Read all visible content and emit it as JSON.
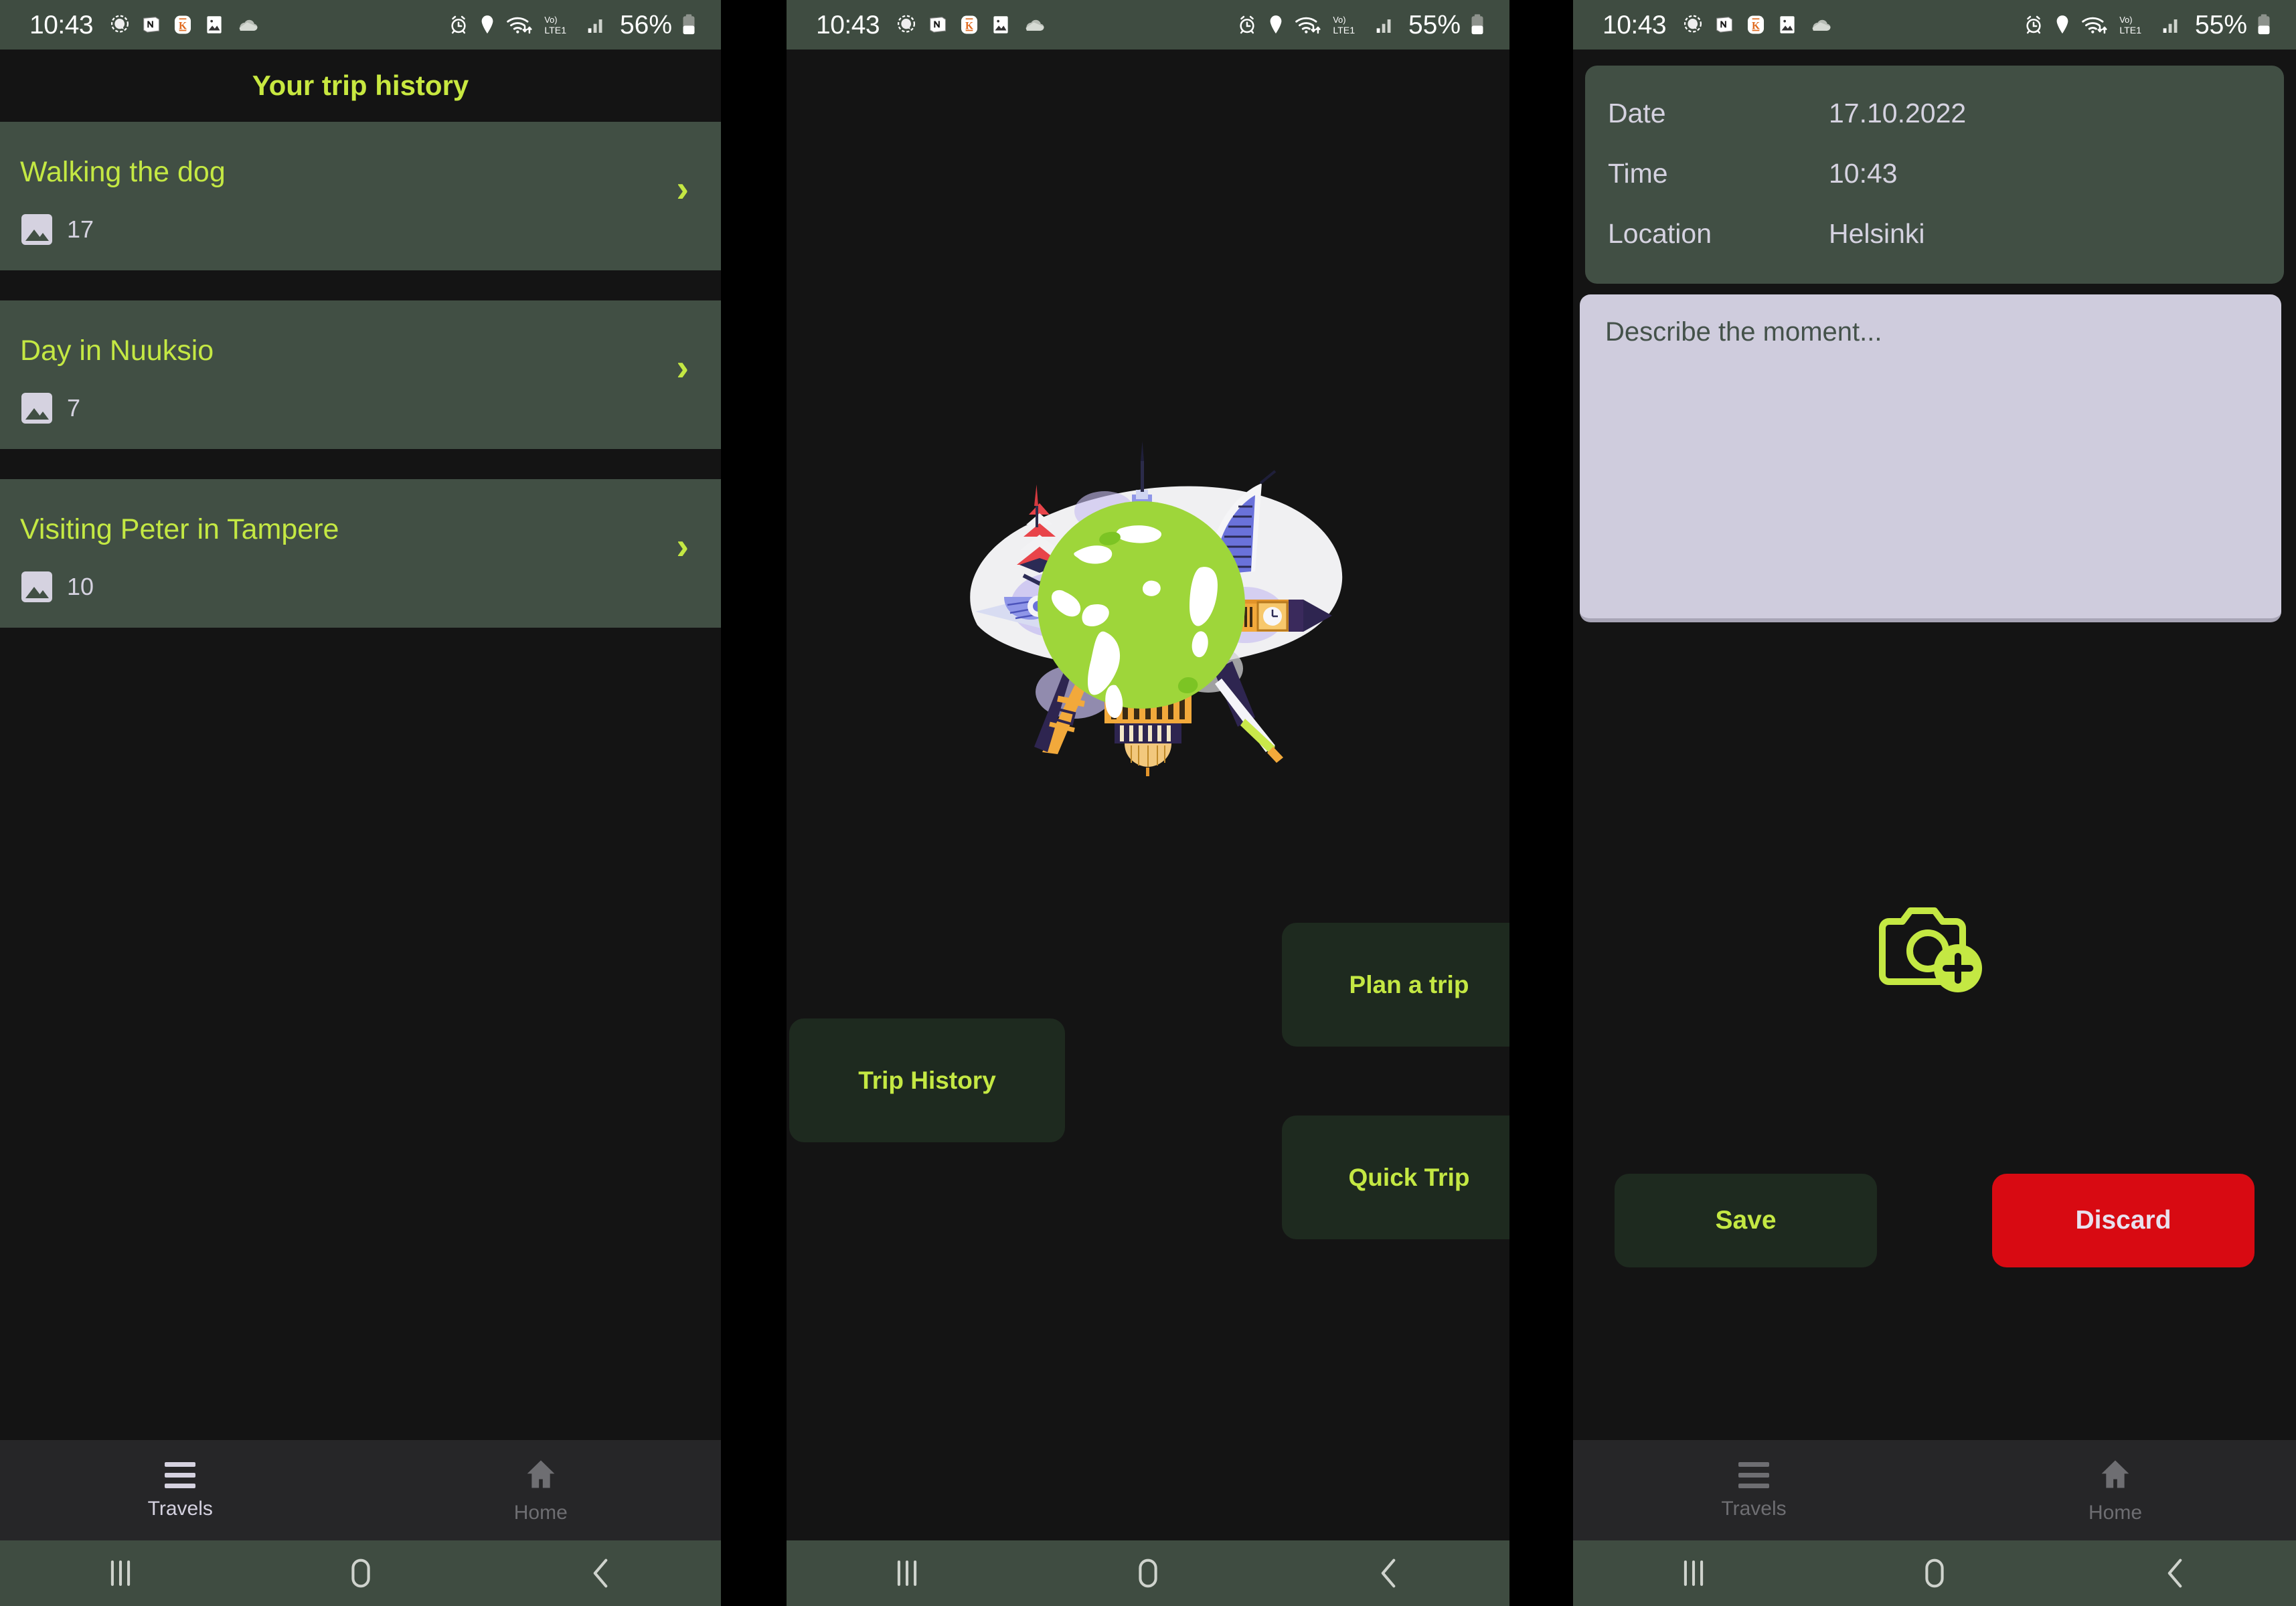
{
  "statusbar": {
    "time": "10:43",
    "battery_left": "56%",
    "battery_mid": "55%",
    "battery_right": "55%",
    "network_label": "VoLTE1",
    "icons": [
      "signal-messenger-icon",
      "notion-icon",
      "kindle-icon",
      "gallery-icon",
      "onedrive-icon",
      "alarm-icon",
      "location-pin-icon",
      "wifi-icon",
      "volte-icon",
      "cellular-signal-icon",
      "battery-icon"
    ]
  },
  "panel1": {
    "title": "Your trip history",
    "trips": [
      {
        "name": "Walking the dog",
        "photos": "17"
      },
      {
        "name": "Day in Nuuksio",
        "photos": "7"
      },
      {
        "name": "Visiting Peter in Tampere",
        "photos": "10"
      }
    ],
    "chevron": "›",
    "nav": {
      "travels": "Travels",
      "home": "Home",
      "active": "Travels"
    }
  },
  "panel2": {
    "buttons": {
      "plan": "Plan a trip",
      "history": "Trip History",
      "quick": "Quick Trip"
    },
    "illustration": "world-travel-globe-landmarks-illustration"
  },
  "panel3": {
    "info": [
      {
        "key": "Date",
        "value": "17.10.2022"
      },
      {
        "key": "Time",
        "value": "10:43"
      },
      {
        "key": "Location",
        "value": "Helsinki"
      }
    ],
    "describe_placeholder": "Describe the moment...",
    "describe_value": "",
    "add_photo_icon": "add-photo-camera-icon",
    "save": "Save",
    "discard": "Discard",
    "nav": {
      "travels": "Travels",
      "home": "Home",
      "active": "none"
    }
  },
  "colors": {
    "accent_lime": "#c4e843",
    "card_green": "#414f44",
    "statusbar_green": "#3f4c41",
    "button_dark_green": "#1e2a1f",
    "danger_red": "#d80a12",
    "lavender": "#d5d2e0",
    "background": "#141414"
  }
}
